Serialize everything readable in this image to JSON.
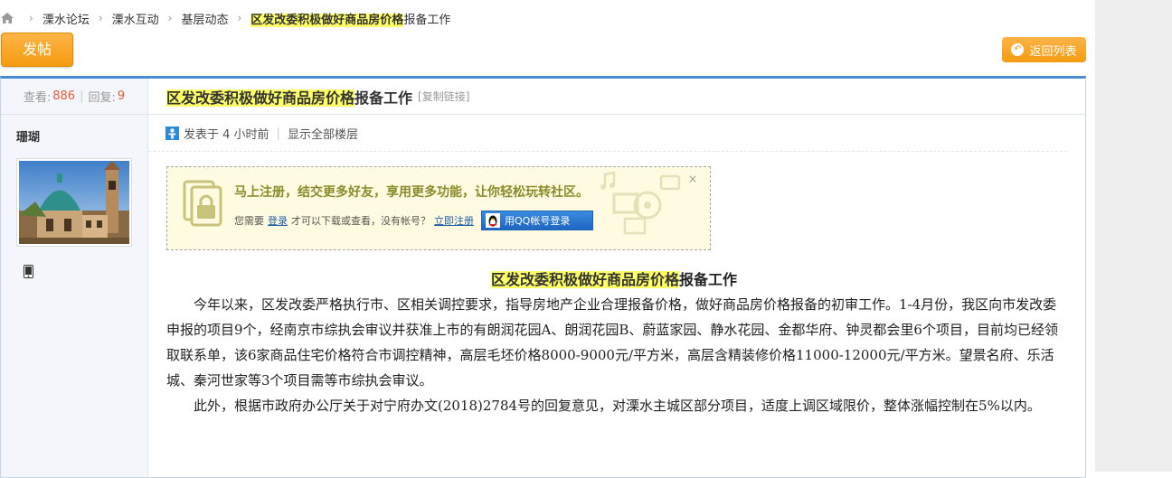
{
  "breadcrumb": {
    "items": [
      "溧水论坛",
      "溧水互动",
      "基层动态"
    ],
    "current_highlight": "区发改委积极做好商品房价格",
    "current_rest": "报备工作"
  },
  "toolbar": {
    "post_label": "发帖",
    "back_label": "返回列表"
  },
  "sidebar": {
    "views_label": "查看:",
    "views": "886",
    "replies_label": "回复:",
    "replies": "9",
    "author": "珊瑚"
  },
  "thread": {
    "title_highlight": "区发改委积极做好商品房价格",
    "title_rest": "报备工作",
    "copy_link": "[复制链接]",
    "posted": "发表于 4 小时前",
    "show_all": "显示全部楼层"
  },
  "register_prompt": {
    "headline": "马上注册，结交更多好友，享用更多功能，让你轻松玩转社区。",
    "need": "您需要",
    "login": "登录",
    "mid": "才可以下载或查看，没有帐号？",
    "register": "立即注册",
    "qq_label": "用QQ帐号登录",
    "close": "×"
  },
  "article": {
    "title_highlight": "区发改委积极做好商品房价格",
    "title_rest": "报备工作",
    "paragraphs": [
      "今年以来，区发改委严格执行市、区相关调控要求，指导房地产企业合理报备价格，做好商品房价格报备的初审工作。1-4月份，我区向市发改委申报的项目9个，经南京市综执会审议并获准上市的有朗润花园A、朗润花园B、蔚蓝家园、静水花园、金都华府、钟灵都会里6个项目，目前均已经领取联系单，该6家商品住宅价格符合市调控精神，高层毛坯价格8000-9000元/平方米，高层含精装修价格11000-12000元/平方米。望景名府、乐活城、秦河世家等3个项目需等市综执会审议。",
      "此外，根据市政府办公厅关于对宁府办文(2018)2784号的回复意见，对溧水主城区部分项目，适度上调区域限价，整体涨幅控制在5%以内。"
    ]
  },
  "colors": {
    "accent_orange": "#f49b10",
    "highlight": "#ffff66",
    "panel_border": "#4a8bd6",
    "stat_number": "#e55a3b",
    "link": "#1d5fa6"
  },
  "icons": [
    "home-icon",
    "return-icon",
    "user-icon",
    "phone-icon",
    "lock-icon",
    "qq-penguin-icon",
    "close-icon"
  ]
}
